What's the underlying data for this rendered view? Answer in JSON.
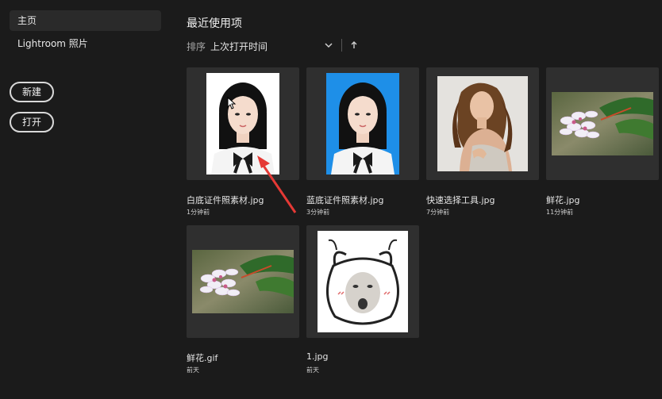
{
  "sidebar": {
    "items": [
      {
        "label": "主页",
        "active": true
      },
      {
        "label": "Lightroom 照片",
        "active": false
      }
    ],
    "buttons": {
      "new_label": "新建",
      "open_label": "打开"
    }
  },
  "main": {
    "title": "最近使用项",
    "sort": {
      "label": "排序",
      "value": "上次打开时间"
    },
    "files": [
      {
        "name": "白底证件照素材.jpg",
        "time": "1分钟前"
      },
      {
        "name": "蓝底证件照素材.jpg",
        "time": "3分钟前"
      },
      {
        "name": "快速选择工具.jpg",
        "time": "7分钟前"
      },
      {
        "name": "鲜花.jpg",
        "time": "11分钟前"
      },
      {
        "name": "鲜花.gif",
        "time": "前天"
      },
      {
        "name": "1.jpg",
        "time": "前天"
      }
    ]
  },
  "colors": {
    "background": "#1b1b1b",
    "card": "#2f2f2f",
    "annotation_arrow": "#e53935"
  }
}
